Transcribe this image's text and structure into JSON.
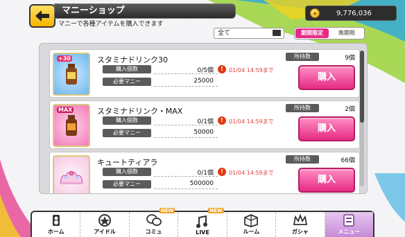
{
  "header": {
    "title": "マニーショップ",
    "subtitle": "マニーで各種アイテムを購入できます",
    "money": "9,776,036"
  },
  "filters": {
    "category": "全て",
    "toggles": [
      "期間限定",
      "無期限"
    ]
  },
  "labels": {
    "buy_count": "購入個数",
    "cost": "必要マニー",
    "owned": "所持数",
    "buy_button": "購入"
  },
  "items": [
    {
      "name": "スタミナドリンク30",
      "badge": "+30",
      "buy_count": "0/5個",
      "cost": "25000",
      "deadline": "01/04 14:59まで",
      "owned": "9個",
      "thumb": "blue"
    },
    {
      "name": "スタミナドリンク・MAX",
      "badge": "MAX",
      "buy_count": "0/1個",
      "cost": "50000",
      "deadline": "01/04 14:59まで",
      "owned": "2個",
      "thumb": "pink"
    },
    {
      "name": "キュートティアラ",
      "badge": "",
      "buy_count": "0/1個",
      "cost": "500000",
      "deadline": "01/04 14:59まで",
      "owned": "66個",
      "thumb": "light"
    }
  ],
  "nav": {
    "items": [
      {
        "label": "ホーム",
        "icon": "home-icon"
      },
      {
        "label": "アイドル",
        "icon": "idol-icon"
      },
      {
        "label": "コミュ",
        "icon": "commu-icon",
        "badge": "NEW"
      },
      {
        "label": "LIVE",
        "icon": "live-icon",
        "badge": "NEW"
      },
      {
        "label": "ルーム",
        "icon": "room-icon"
      },
      {
        "label": "ガシャ",
        "icon": "gacha-icon"
      },
      {
        "label": "メニュー",
        "icon": "menu-icon"
      }
    ]
  },
  "colors": {
    "accent": "#e52b84",
    "deadline": "#e23b3b",
    "dark": "#2b2b2b"
  }
}
